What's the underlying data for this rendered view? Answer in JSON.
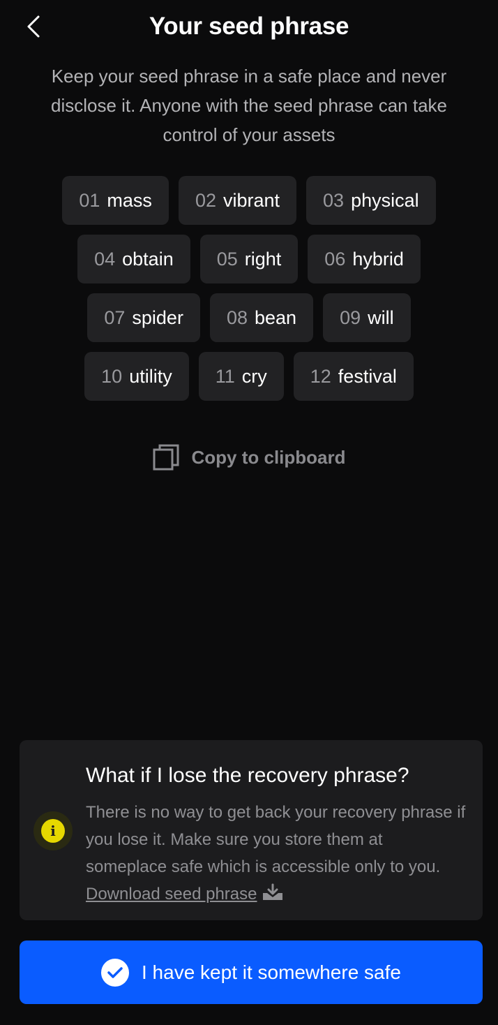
{
  "header": {
    "title": "Your seed phrase"
  },
  "subtitle": "Keep your seed phrase in a safe place and never disclose it. Anyone with the seed phrase can take control of your assets",
  "seed_words": [
    {
      "num": "01",
      "word": "mass"
    },
    {
      "num": "02",
      "word": "vibrant"
    },
    {
      "num": "03",
      "word": "physical"
    },
    {
      "num": "04",
      "word": "obtain"
    },
    {
      "num": "05",
      "word": "right"
    },
    {
      "num": "06",
      "word": "hybrid"
    },
    {
      "num": "07",
      "word": "spider"
    },
    {
      "num": "08",
      "word": "bean"
    },
    {
      "num": "09",
      "word": "will"
    },
    {
      "num": "10",
      "word": "utility"
    },
    {
      "num": "11",
      "word": "cry"
    },
    {
      "num": "12",
      "word": "festival"
    }
  ],
  "copy": {
    "label": "Copy to clipboard",
    "icon": "copy-icon"
  },
  "info": {
    "icon": "info-icon",
    "icon_glyph": "i",
    "title": "What if I lose the recovery phrase?",
    "body": "There is no way to get back your recovery phrase if you lose it. Make sure you store them at someplace safe which is accessible only to you.",
    "link_label": "Download seed phrase",
    "link_icon": "download-icon"
  },
  "confirm": {
    "label": "I have kept it somewhere safe",
    "icon": "check-circle-icon"
  },
  "colors": {
    "background": "#0b0b0c",
    "chip": "#222224",
    "card": "#1c1c1e",
    "accent": "#0a5cff",
    "info_yellow": "#e6d800"
  }
}
